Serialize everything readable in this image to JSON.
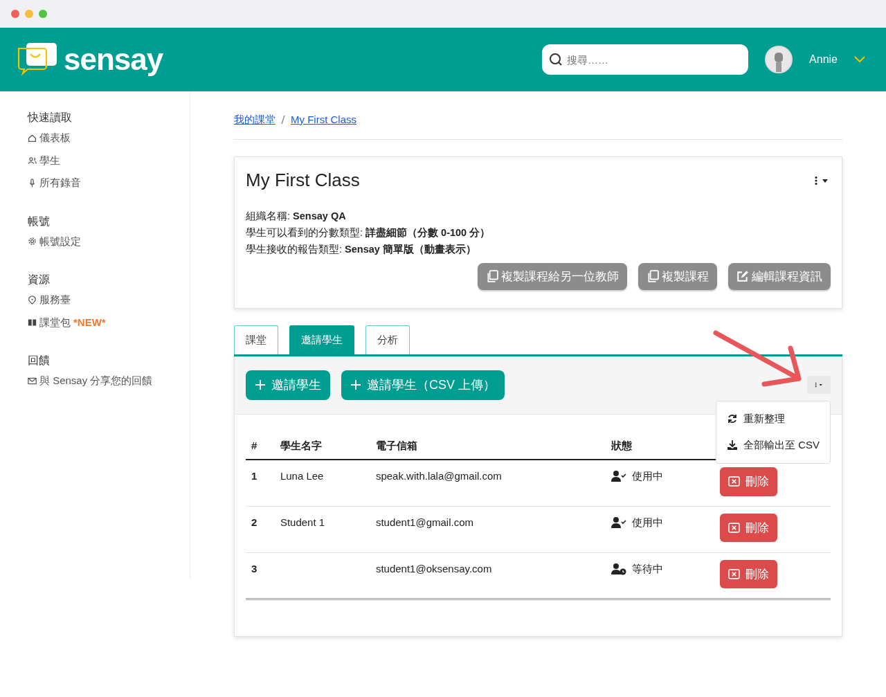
{
  "header": {
    "brand": "sensay",
    "search": {
      "placeholder": "搜尋……"
    },
    "user": {
      "name": "Annie"
    }
  },
  "sidebar": {
    "sections": [
      {
        "title": "快速讀取",
        "items": [
          {
            "label": "儀表板"
          },
          {
            "label": "學生"
          },
          {
            "label": "所有錄音"
          }
        ]
      },
      {
        "title": "帳號",
        "items": [
          {
            "label": "帳號設定"
          }
        ]
      },
      {
        "title": "資源",
        "items": [
          {
            "label": "服務臺"
          },
          {
            "label": "課堂包",
            "badge": "*NEW*"
          }
        ]
      },
      {
        "title": "回饋",
        "items": [
          {
            "label": "與 Sensay 分享您的回饋"
          }
        ]
      }
    ]
  },
  "breadcrumb": [
    "我的課堂",
    "My First Class"
  ],
  "class_card": {
    "title": "My First Class",
    "details": [
      "組織名稱: **Sensay QA**",
      "學生可以看到的分數類型: **詳盡細節（分數 0-100 分）**",
      "學生接收的報告類型: **Sensay 簡單版（動畫表示）**"
    ],
    "buttons": [
      "複製課程給另一位教師",
      "複製課程",
      "編輯課程資訊"
    ]
  },
  "tabs": [
    {
      "label": "課堂",
      "selected": false
    },
    {
      "label": "邀請學生",
      "selected": true
    },
    {
      "label": "分析",
      "selected": false
    }
  ],
  "toolbar": {
    "buttons": [
      "邀請學生",
      "邀請學生（CSV 上傳）"
    ],
    "menu": {
      "open": true,
      "items": [
        "重新整理",
        "全部輸出至 CSV"
      ]
    }
  },
  "table": {
    "columns": [
      "#",
      "學生名字",
      "電子信箱",
      "狀態"
    ],
    "rows": [
      {
        "num": "1",
        "name": "Luna Lee",
        "email": "speak.with.lala@gmail.com",
        "status": "使用中",
        "kind": "active",
        "action": "刪除"
      },
      {
        "num": "2",
        "name": "Student 1",
        "email": "student1@gmail.com",
        "status": "使用中",
        "kind": "active",
        "action": "刪除"
      },
      {
        "num": "3",
        "email": "student1@oksensay.com",
        "status": "等待中",
        "kind": "pending",
        "action": "刪除"
      }
    ]
  }
}
